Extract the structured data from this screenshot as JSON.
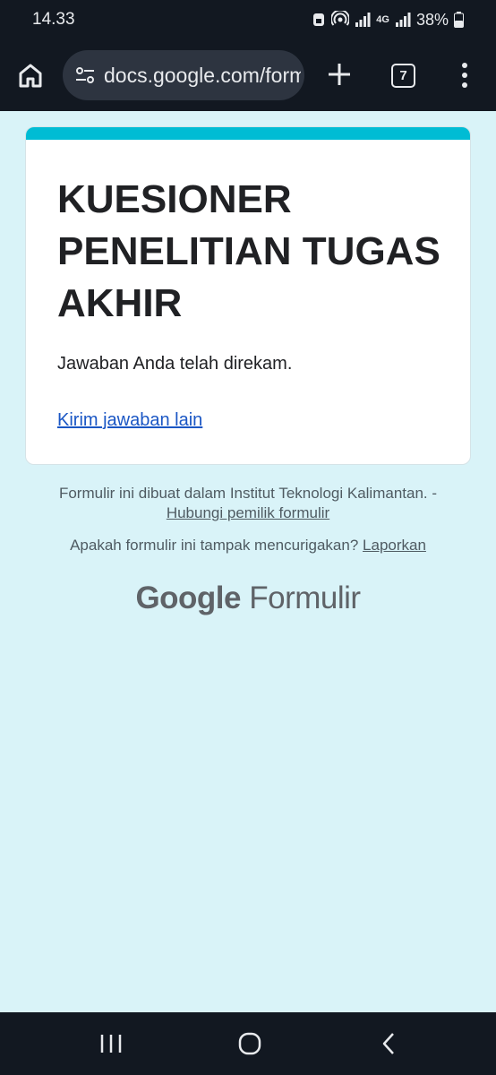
{
  "status_bar": {
    "time": "14.33",
    "network": "4G",
    "battery": "38%"
  },
  "browser": {
    "url": "docs.google.com/forms",
    "tab_count": "7",
    "icons": [
      "home-icon",
      "tune-icon",
      "plus-icon",
      "tabs-icon",
      "more-vert-icon"
    ]
  },
  "form": {
    "title": "KUESIONER PENELITIAN TUGAS AKHIR",
    "confirmation": "Jawaban Anda telah direkam.",
    "submit_another": "Kirim jawaban lain"
  },
  "footer": {
    "made_in": "Formulir ini dibuat dalam Institut Teknologi Kalimantan. -",
    "contact_owner": "Hubungi pemilik formulir",
    "suspicious": "Apakah formulir ini tampak mencurigakan?",
    "report": "Laporkan",
    "logo_google": "Google",
    "logo_forms": "Formulir"
  },
  "colors": {
    "accent": "#00bcd4",
    "page_bg": "#d9f3f8",
    "link": "#1a56c4",
    "system_bar": "#121821"
  },
  "nav_bar": {
    "icons": [
      "recent-apps-icon",
      "home-nav-icon",
      "back-icon"
    ]
  }
}
